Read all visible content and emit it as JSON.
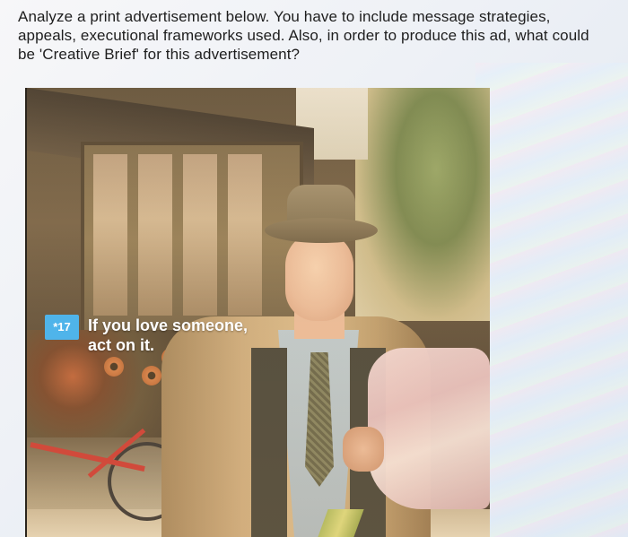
{
  "question": {
    "lines": [
      "Analyze a print advertisement below. You have to include message strategies,",
      "appeals, executional frameworks used. Also, in order to produce this ad, what could",
      "be 'Creative Brief' for this advertisement?"
    ]
  },
  "ad": {
    "badge": "*17",
    "tagline_lines": [
      "If you love someone,",
      "act on it."
    ]
  },
  "colors": {
    "badge_bg": "#4fb4ea",
    "tagline_text": "#ffffff"
  }
}
